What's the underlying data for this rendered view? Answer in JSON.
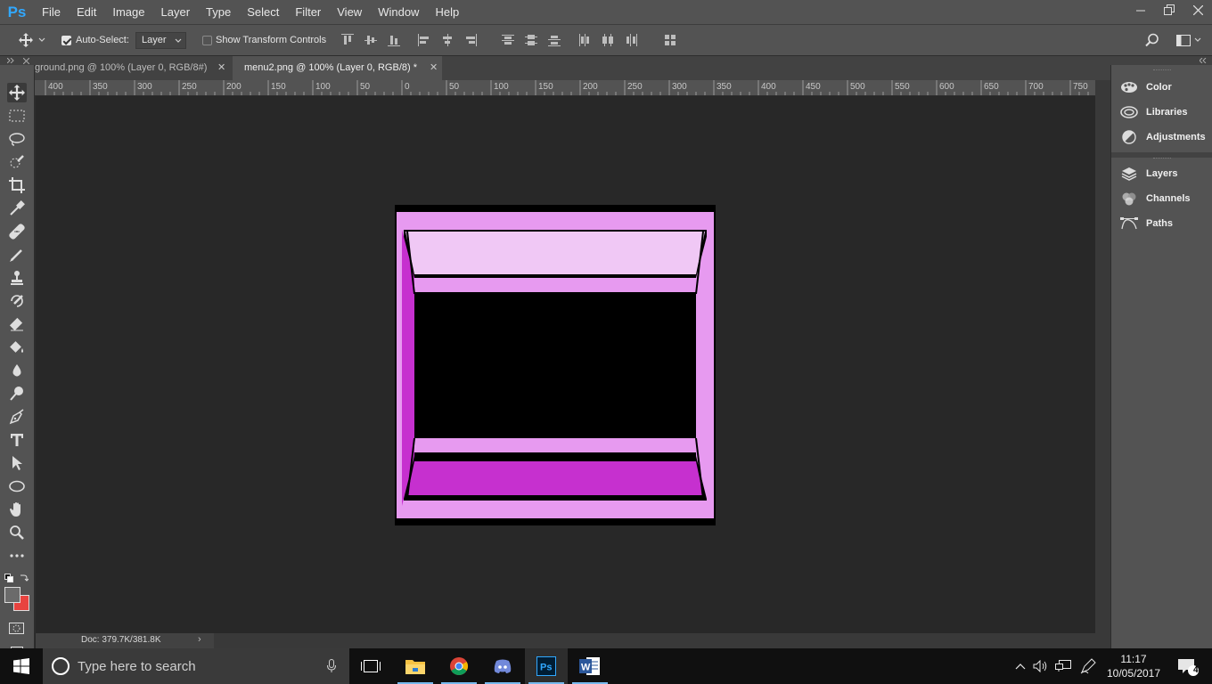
{
  "app": {
    "logo": "Ps",
    "menu": [
      "File",
      "Edit",
      "Image",
      "Layer",
      "Type",
      "Select",
      "Filter",
      "View",
      "Window",
      "Help"
    ],
    "window_controls": [
      "minimize",
      "restore",
      "close"
    ]
  },
  "options_bar": {
    "auto_select_label": "Auto-Select:",
    "auto_select_checked": true,
    "auto_select_target": "Layer",
    "transform_controls_label": "Show Transform Controls",
    "transform_controls_checked": false
  },
  "tabs": [
    {
      "label": "ground.png @ 100% (Layer 0, RGB/8#)",
      "active": false
    },
    {
      "label": "menu2.png @ 100% (Layer 0, RGB/8) *",
      "active": true
    }
  ],
  "ruler": {
    "labels": [
      "400",
      "350",
      "300",
      "250",
      "200",
      "150",
      "100",
      "50",
      "0",
      "50",
      "100",
      "150",
      "200",
      "250",
      "300",
      "350",
      "400",
      "450",
      "500",
      "550",
      "600",
      "650",
      "700",
      "750"
    ]
  },
  "tools": [
    "move-tool",
    "marquee-tool",
    "lasso-tool",
    "quick-selection-tool",
    "crop-tool",
    "eyedropper-tool",
    "healing-brush-tool",
    "brush-tool",
    "clone-stamp-tool",
    "history-brush-tool",
    "eraser-tool",
    "paint-bucket-tool",
    "blur-tool",
    "dodge-tool",
    "pen-tool",
    "type-tool",
    "path-selection-tool",
    "ellipse-tool",
    "hand-tool",
    "zoom-tool",
    "more-tools"
  ],
  "colors": {
    "foreground": "#6b6b6b",
    "background": "#e8433f",
    "artwork_light": "#f0c8f5",
    "artwork_mid": "#e79af0",
    "artwork_deep": "#c630cf",
    "artwork_edge": "#000000"
  },
  "status": {
    "doc_info": "Doc: 379.7K/381.8K"
  },
  "panels": {
    "group1": [
      "Color",
      "Libraries",
      "Adjustments"
    ],
    "group2": [
      "Layers",
      "Channels",
      "Paths"
    ]
  },
  "taskbar": {
    "search_placeholder": "Type here to search",
    "time": "11:17",
    "date": "10/05/2017",
    "notification_count": "4"
  }
}
